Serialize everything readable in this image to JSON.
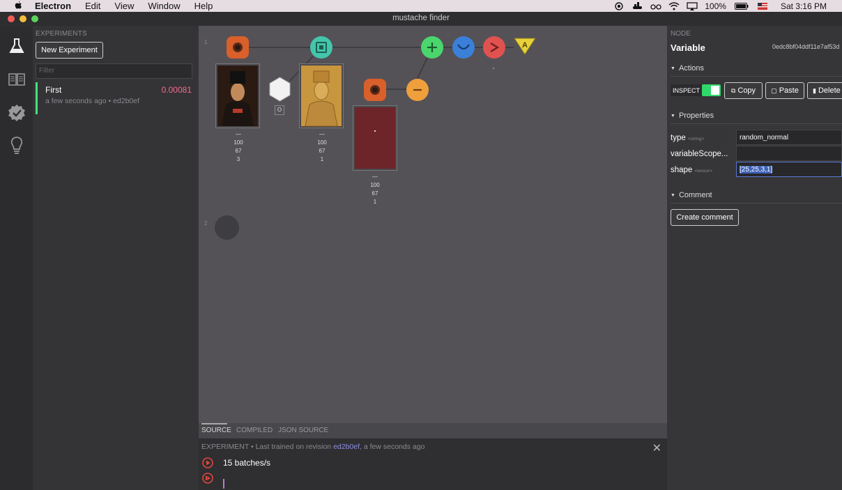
{
  "menubar": {
    "app": "Electron",
    "items": [
      "Edit",
      "View",
      "Window",
      "Help"
    ],
    "battery": "100%",
    "clock": "Sat 3:16 PM"
  },
  "window": {
    "title": "mustache finder"
  },
  "experiments": {
    "header": "EXPERIMENTS",
    "new_button": "New Experiment",
    "filter_placeholder": "Filter",
    "items": [
      {
        "name": "First",
        "score": "0.00081",
        "subtitle": "a few seconds ago • ed2b0ef"
      }
    ]
  },
  "canvas": {
    "rows": [
      "1",
      "2"
    ],
    "output_shapes": [
      {
        "dims": [
          "100",
          "67",
          "3"
        ]
      },
      {
        "dims": [
          "100",
          "67",
          "1"
        ]
      },
      {
        "dims": [
          "100",
          "67",
          "1"
        ]
      }
    ],
    "placeholder_glyph": "O",
    "dash": "—"
  },
  "tabs": [
    "SOURCE",
    "COMPILED",
    "JSON SOURCE"
  ],
  "output": {
    "prefix": "EXPERIMENT • Last trained on revision ",
    "revision": "ed2b0ef",
    "suffix": ", a few seconds ago",
    "metric": "15 batches/s",
    "close": "✕"
  },
  "inspector": {
    "header": "NODE",
    "node_type": "Variable",
    "node_id": "0edc8bf04ddf11e7af53d",
    "actions_label": "Actions",
    "inspect_label": "INSPECT",
    "copy_label": "Copy",
    "paste_label": "Paste",
    "delete_label": "Delete",
    "properties_label": "Properties",
    "properties": [
      {
        "key": "type",
        "type_hint": "<string>",
        "value": "random_normal"
      },
      {
        "key": "variableScope...",
        "type_hint": "",
        "value": ""
      },
      {
        "key": "shape",
        "type_hint": "<tensor>",
        "value": "[25,25,3,1]"
      }
    ],
    "comment_label": "Comment",
    "create_comment": "Create comment"
  },
  "colors": {
    "accent_green": "#48e07a",
    "score_pink": "#f06e8a",
    "node_orange": "#d95f2b",
    "node_teal": "#43c6ac",
    "node_green": "#4ad66d",
    "node_blue": "#3b7fd9",
    "node_red": "#e0524f",
    "node_yellow": "#e8d23b",
    "node_amber": "#ef9f3c"
  }
}
